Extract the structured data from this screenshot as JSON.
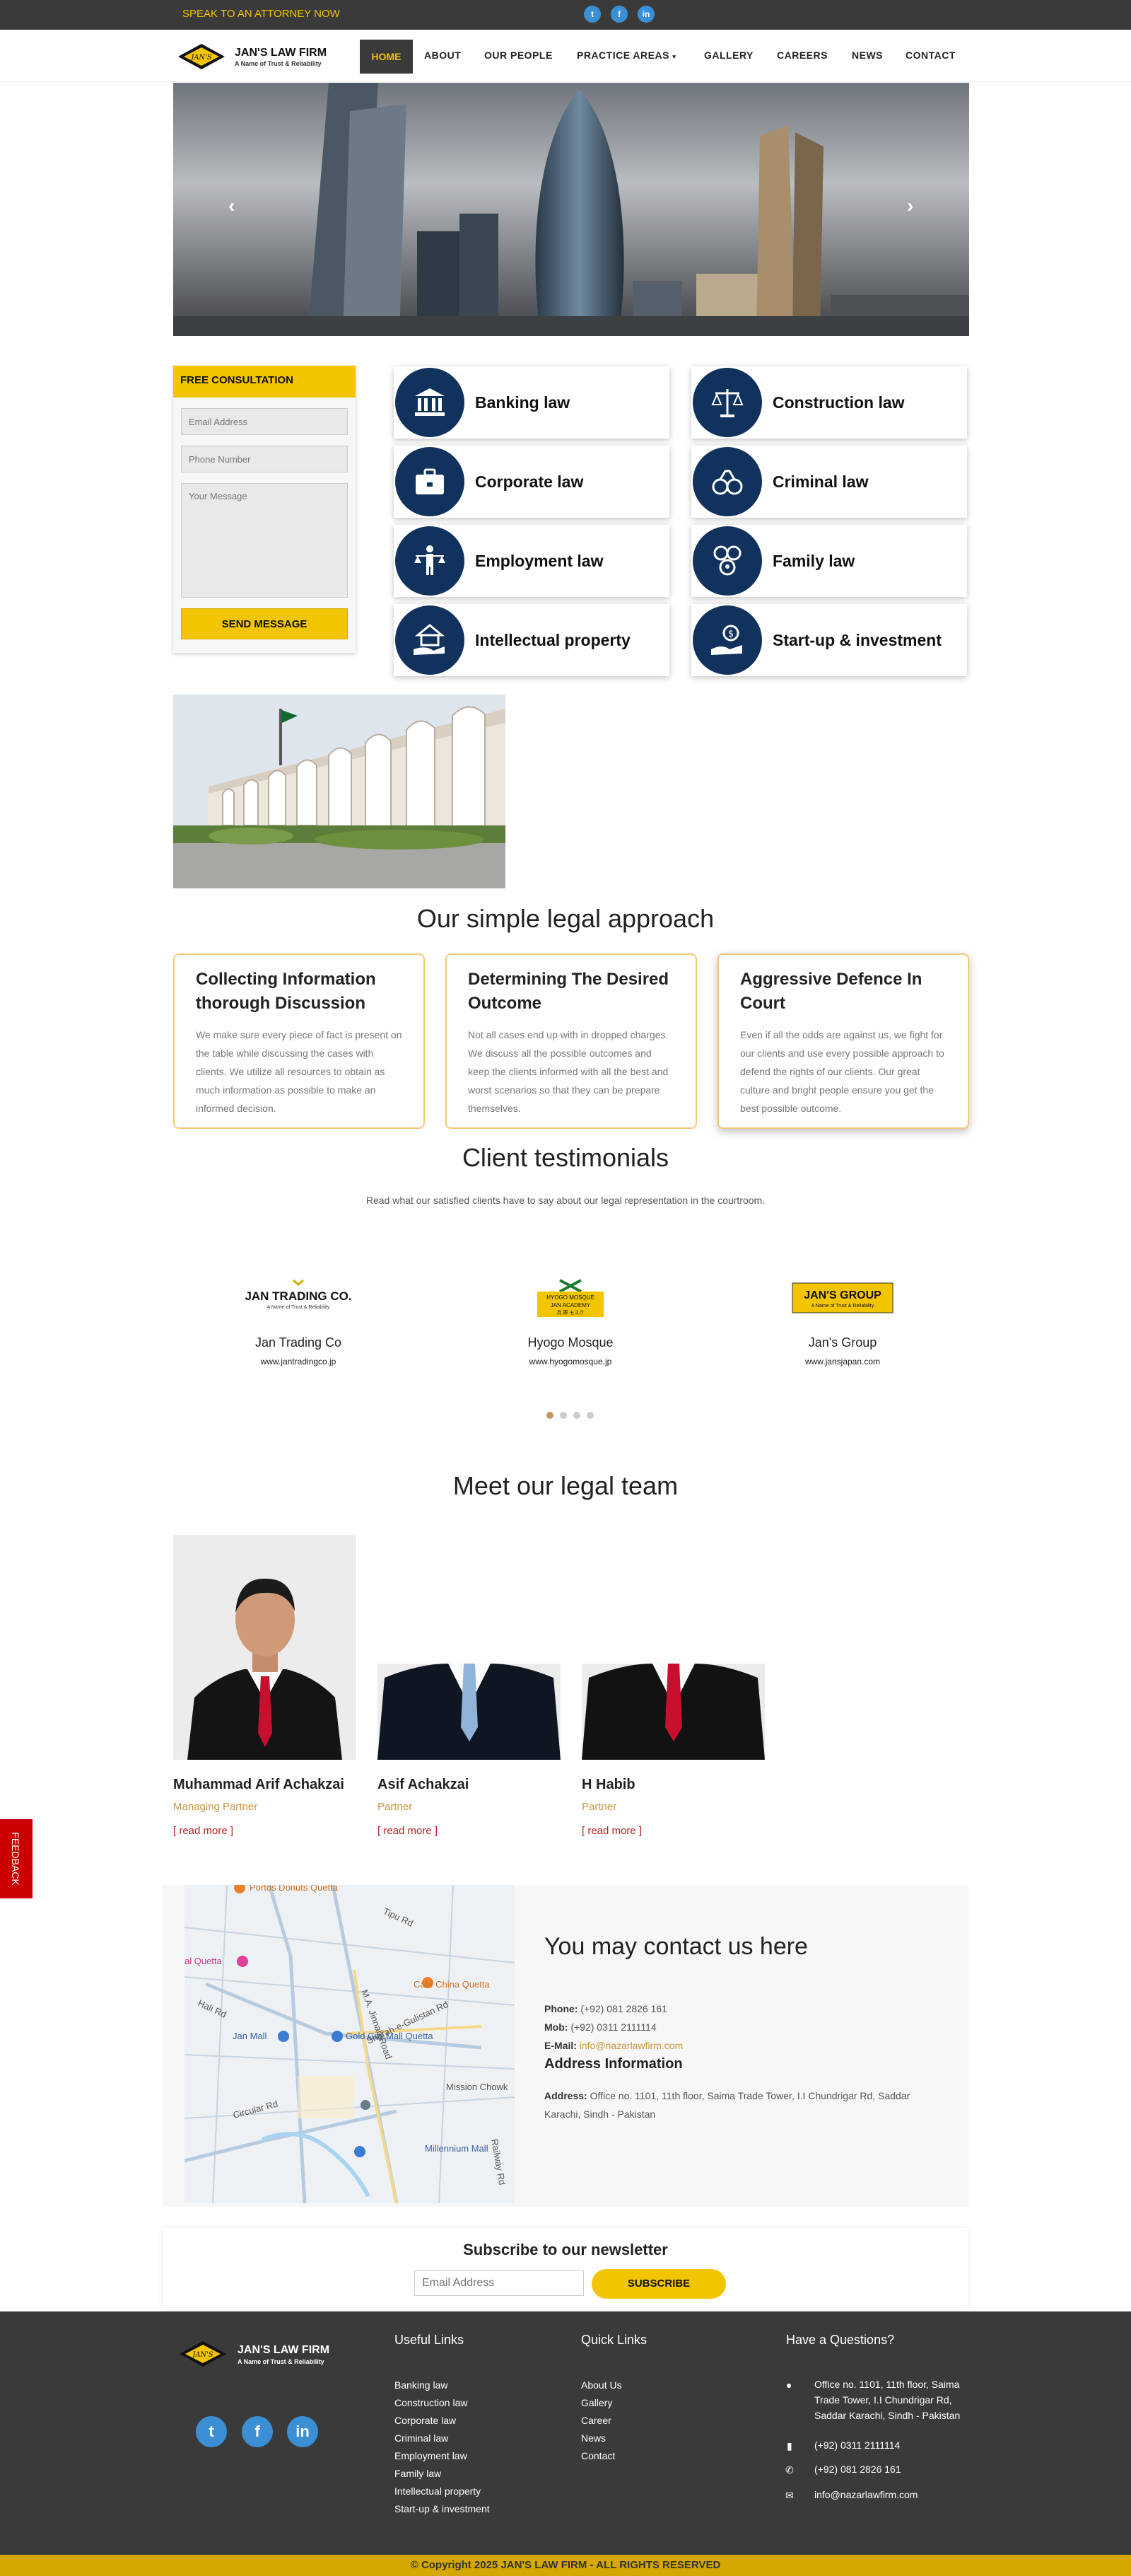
{
  "topbar": {
    "speak": "SPEAK TO AN ATTORNEY NOW",
    "social": [
      "twitter-icon",
      "facebook-icon",
      "linkedin-icon"
    ]
  },
  "brand": {
    "name": "JAN'S LAW FIRM",
    "tagline": "A Name of Trust & Reliability",
    "mark": "JAN'S"
  },
  "nav": {
    "items": [
      "HOME",
      "ABOUT",
      "OUR PEOPLE",
      "PRACTICE AREAS",
      "GALLERY",
      "CAREERS",
      "NEWS",
      "CONTACT"
    ],
    "active": "HOME"
  },
  "hero": {
    "prev": "‹",
    "next": "›"
  },
  "consultation": {
    "title": "FREE CONSULTATION",
    "email_placeholder": "Email Address",
    "phone_placeholder": "Phone Number",
    "message_placeholder": "Your Message",
    "submit": "SEND MESSAGE"
  },
  "practice": [
    {
      "label": "Banking law",
      "icon": "bank-icon"
    },
    {
      "label": "Construction law",
      "icon": "scales-icon"
    },
    {
      "label": "Corporate law",
      "icon": "briefcase-icon"
    },
    {
      "label": "Criminal law",
      "icon": "handcuffs-icon"
    },
    {
      "label": "Employment law",
      "icon": "employee-scales-icon"
    },
    {
      "label": "Family law",
      "icon": "family-icon"
    },
    {
      "label": "Intellectual property",
      "icon": "house-hand-icon"
    },
    {
      "label": "Start-up & investment",
      "icon": "money-hand-icon"
    }
  ],
  "approach": {
    "title": "Our simple legal approach",
    "cards": [
      {
        "title": "Collecting Information thorough Discussion",
        "text": "We make sure every piece of fact is present on the table while discussing the cases with clients. We utilize all resources to obtain as much information as possible to make an informed decision."
      },
      {
        "title": "Determining The Desired Outcome",
        "text": "Not all cases end up with in dropped charges. We discuss all the possible outcomes and keep the clients informed with all the best and worst scenarios so that they can be prepare themselves."
      },
      {
        "title": "Aggressive Defence In Court",
        "text": "Even if all the odds are against us, we fight for our clients and use every possible approach to defend the rights of our clients. Our great culture and bright people ensure you get the best possible outcome."
      }
    ]
  },
  "testimonials": {
    "title": "Client testimonials",
    "subtitle": "Read what our satisfied clients have to say about our legal representation in the courtroom.",
    "clients": [
      {
        "name": "Jan Trading Co",
        "url": "www.jantradingco.jp",
        "logo_text": "JAN TRADING CO.",
        "logo_sub": "A Name of Trust & Reliability"
      },
      {
        "name": "Hyogo Mosque",
        "url": "www.hyogomosque.jp",
        "logo_text": "HYOGO MOSQUE",
        "logo_sub": "JAN ACADEMY"
      },
      {
        "name": "Jan's Group",
        "url": "www.jansjapan.com",
        "logo_text": "JAN'S GROUP",
        "logo_sub": "A Name of Trust & Reliability"
      }
    ],
    "active_dot": 0,
    "dots": 4
  },
  "team": {
    "title": "Meet our legal team",
    "members": [
      {
        "name": "Muhammad Arif Achakzai",
        "role": "Managing Partner",
        "more": "[ read more ]",
        "tie": "#c8102e"
      },
      {
        "name": "Asif Achakzai",
        "role": "Partner",
        "more": "[ read more ]",
        "tie": "#8fb3d9"
      },
      {
        "name": "H Habib",
        "role": "Partner",
        "more": "[ read more ]",
        "tie": "#c8102e"
      }
    ]
  },
  "feedback": "FEEDBACK",
  "contact": {
    "title": "You may contact us here",
    "phone_label": "Phone:",
    "phone": "(+92) 081 2826 161",
    "mob_label": "Mob:",
    "mob": "(+92) 0311 2111114",
    "email_label": "E-Mail:",
    "email": "info@nazarlawfirm.com",
    "address_title": "Address Information",
    "address_label": "Address:",
    "address": "Office no. 1101, 11th floor, Saima Trade Tower, I.I Chundrigar Rd, Saddar Karachi, Sindh - Pakistan",
    "map_labels": [
      "Portos Donuts Quetta",
      "al Quetta",
      "Tipu Rd",
      "Cafe China Quetta",
      "Jan Mall",
      "Gold City Mall Quetta",
      "Mission Chowk",
      "Circular Rd",
      "Millennium Mall",
      "Hali Rd",
      "M.A. Jinnah Road",
      "Sharah-e-Gulistan Rd",
      "Railway Rd"
    ]
  },
  "newsletter": {
    "title": "Subscribe to our newsletter",
    "placeholder": "Email Address",
    "button": "SUBSCRIBE"
  },
  "footer": {
    "useful_title": "Useful Links",
    "useful": [
      "Banking law",
      "Construction law",
      "Corporate law",
      "Criminal law",
      "Employment law",
      "Family law",
      "Intellectual property",
      "Start-up & investment"
    ],
    "quick_title": "Quick Links",
    "quick": [
      "About Us",
      "Gallery",
      "Career",
      "News",
      "Contact"
    ],
    "question_title": "Have a Questions?",
    "address": "Office no. 1101, 11th floor, Saima Trade Tower, I.I Chundrigar Rd, Saddar Karachi, Sindh - Pakistan",
    "mobile": "(+92) 0311 2111114",
    "phone": "(+92) 081 2826 161",
    "email": "info@nazarlawfirm.com",
    "copyright": "© Copyright 2025 JAN'S LAW FIRM - ALL RIGHTS RESERVED"
  },
  "colors": {
    "accent": "#f2c500",
    "navy": "#10325c",
    "dark": "#3a3a3a",
    "role": "#c8963e"
  }
}
